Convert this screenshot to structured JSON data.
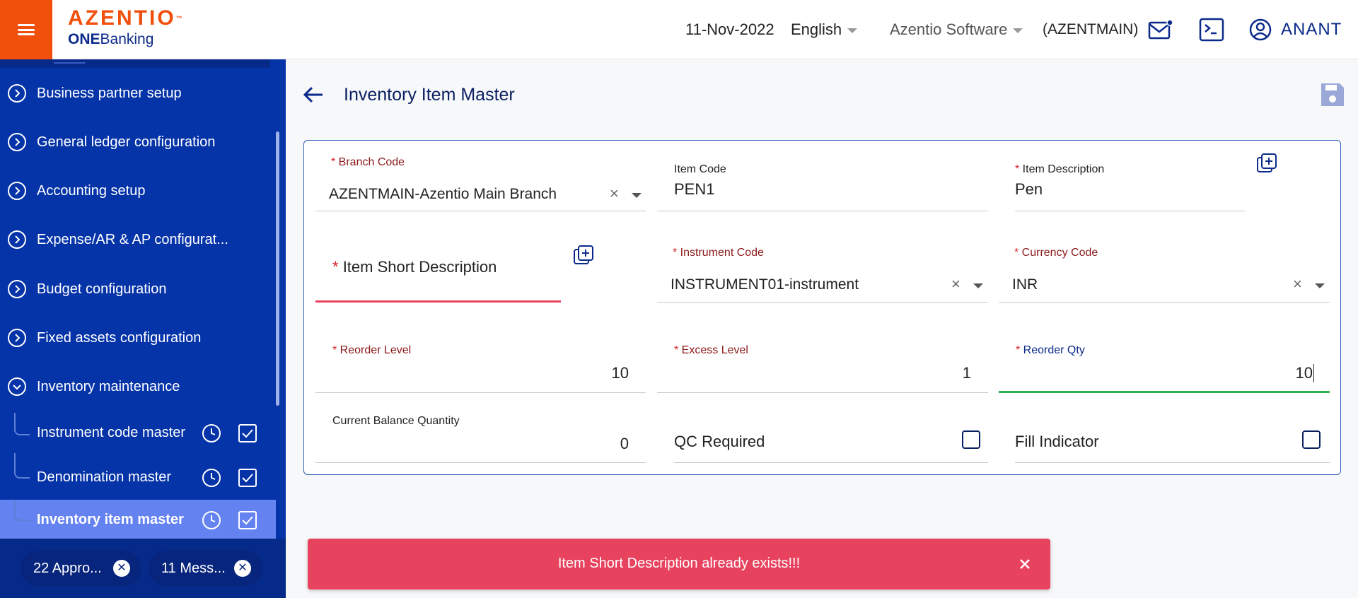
{
  "header": {
    "brand": "AZENTIO",
    "brand_tm": "™",
    "product_bold": "ONE",
    "product_rest": "Banking",
    "date": "11-Nov-2022",
    "language": "English",
    "company": "Azentio Software",
    "branch": "(AZENTMAIN)",
    "user": "ANANT"
  },
  "sidebar": {
    "items": [
      {
        "label": "Business partner setup"
      },
      {
        "label": "General ledger configuration"
      },
      {
        "label": "Accounting setup"
      },
      {
        "label": "Expense/AR & AP configurat..."
      },
      {
        "label": "Budget configuration"
      },
      {
        "label": "Fixed assets configuration"
      },
      {
        "label": "Inventory maintenance"
      }
    ],
    "subitems": [
      {
        "label": "Instrument code master"
      },
      {
        "label": "Denomination master"
      },
      {
        "label": "Inventory item master"
      }
    ],
    "footer": {
      "approvals": "22 Appro...",
      "messages": "11 Mess..."
    }
  },
  "page": {
    "title": "Inventory Item Master"
  },
  "form": {
    "branch_code": {
      "label": "Branch Code",
      "value": "AZENTMAIN-Azentio Main Branch"
    },
    "item_code": {
      "label": "Item Code",
      "value": "PEN1"
    },
    "item_description": {
      "label": "Item Description",
      "value": "Pen"
    },
    "item_short_description": {
      "label": "Item Short Description",
      "value": ""
    },
    "instrument_code": {
      "label": "Instrument Code",
      "value": "INSTRUMENT01-instrument"
    },
    "currency_code": {
      "label": "Currency Code",
      "value": "INR"
    },
    "reorder_level": {
      "label": "Reorder Level",
      "value": "10"
    },
    "excess_level": {
      "label": "Excess Level",
      "value": "1"
    },
    "reorder_qty": {
      "label": "Reorder Qty",
      "value": "10"
    },
    "current_balance_quantity": {
      "label": "Current Balance Quantity",
      "value": "0"
    },
    "qc_required": {
      "label": "QC Required",
      "checked": false
    },
    "fill_indicator": {
      "label": "Fill Indicator",
      "checked": false
    }
  },
  "toast": {
    "message": "Item Short Description already exists!!!"
  },
  "colors": {
    "brand_orange": "#f04f0c",
    "sidebar_blue": "#0533a8",
    "active_item": "#6482f0",
    "error_red": "#e8435e",
    "success_green": "#2bb24c"
  },
  "icons": {
    "menu": "menu-icon",
    "mail": "mail-icon",
    "terminal": "terminal-icon",
    "user": "user-icon",
    "back": "arrow-left-icon",
    "save": "save-icon",
    "copy": "copy-add-icon",
    "clock": "clock-icon",
    "check": "checkbox-checked-icon"
  }
}
